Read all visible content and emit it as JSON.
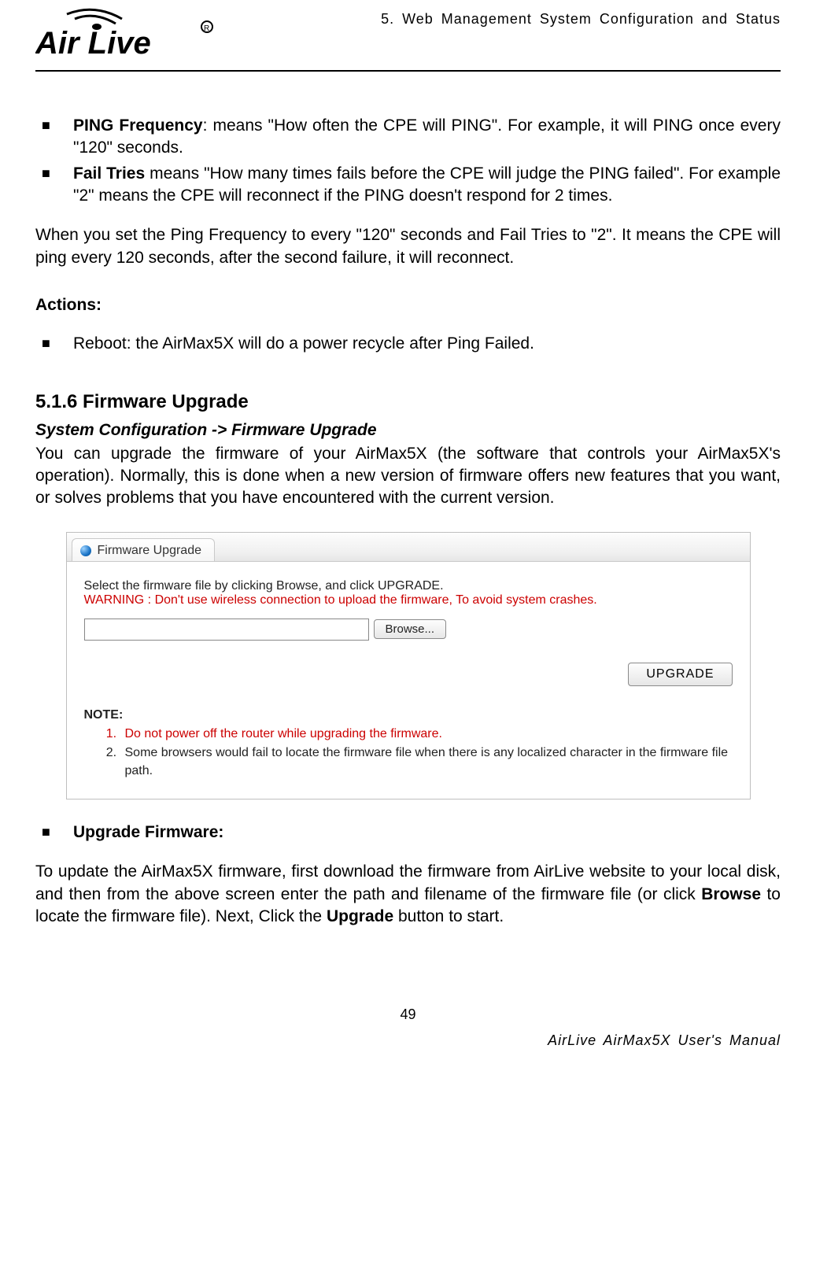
{
  "header": {
    "logo_text": "Air Live",
    "chapter": "5. Web Management System Configuration and Status"
  },
  "bullets_top": [
    {
      "term": "PING Frequency",
      "rest": ": means \"How often the CPE will PING\". For example, it will PING once every \"120\" seconds."
    },
    {
      "term": "Fail Tries",
      "rest": " means \"How many times fails before the CPE will judge the PING failed\". For example \"2\" means the CPE will reconnect if the PING doesn't respond for 2 times."
    }
  ],
  "para_example": "When you set the Ping Frequency to every \"120\" seconds and Fail Tries to \"2\". It means the CPE will ping every 120 seconds, after the second failure, it will reconnect.",
  "actions_heading": "Actions:",
  "actions_bullet": "Reboot: the AirMax5X will do a power recycle after Ping Failed.",
  "section": {
    "number_title": "5.1.6 Firmware Upgrade",
    "breadcrumb": "System Configuration -> Firmware Upgrade",
    "intro": "You can upgrade the firmware of your AirMax5X (the software that controls your AirMax5X's operation). Normally, this is done when a new version of firmware offers new features that you want, or solves problems that you have encountered with the current version."
  },
  "screenshot": {
    "tab_label": "Firmware Upgrade",
    "instruction": "Select the firmware file by clicking Browse, and click UPGRADE.",
    "warning": "WARNING : Don't use wireless connection to upload the firmware, To avoid system crashes.",
    "browse_label": "Browse...",
    "upgrade_label": "UPGRADE",
    "note_label": "NOTE:",
    "notes": [
      "Do not power off the router while upgrading the firmware.",
      "Some browsers would fail to locate the firmware file when there is any localized character in the firmware file path."
    ]
  },
  "upgrade_heading": "Upgrade Firmware:",
  "upgrade_para_parts": {
    "p1": "To update the AirMax5X firmware, first download the firmware from AirLive website to your local disk, and then from the above screen enter the path and filename of the firmware file (or click ",
    "b1": "Browse",
    "p2": " to locate the firmware file). Next, Click the ",
    "b2": "Upgrade",
    "p3": " button to start."
  },
  "footer": {
    "page": "49",
    "right": "AirLive AirMax5X User's Manual"
  }
}
